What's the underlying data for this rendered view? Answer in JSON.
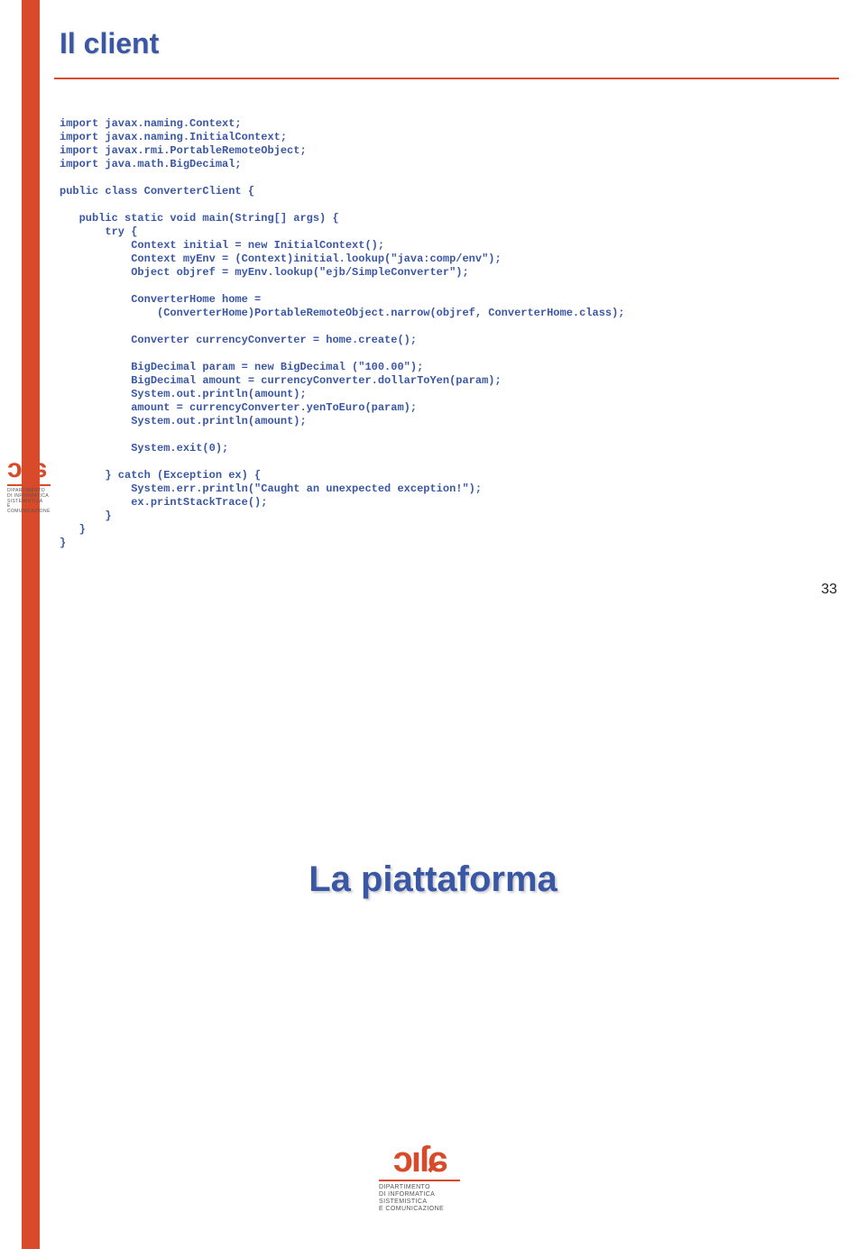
{
  "slide1": {
    "title": "Il client",
    "page_number": "33",
    "code": "import javax.naming.Context;\nimport javax.naming.InitialContext;\nimport javax.rmi.PortableRemoteObject;\nimport java.math.BigDecimal;\n\npublic class ConverterClient {\n\n   public static void main(String[] args) {\n       try {\n           Context initial = new InitialContext();\n           Context myEnv = (Context)initial.lookup(\"java:comp/env\");\n           Object objref = myEnv.lookup(\"ejb/SimpleConverter\");\n\n           ConverterHome home =\n               (ConverterHome)PortableRemoteObject.narrow(objref, ConverterHome.class);\n\n           Converter currencyConverter = home.create();\n\n           BigDecimal param = new BigDecimal (\"100.00\");\n           BigDecimal amount = currencyConverter.dollarToYen(param);\n           System.out.println(amount);\n           amount = currencyConverter.yenToEuro(param);\n           System.out.println(amount);\n\n           System.exit(0);\n\n       } catch (Exception ex) {\n           System.err.println(\"Caught an unexpected exception!\");\n           ex.printStackTrace();\n       }\n   }\n}"
  },
  "slide2": {
    "title": "La piattaforma"
  },
  "logo": {
    "glyph": "ↄıſɕ",
    "line1": "DIPARTIMENTO",
    "line2": "DI INFORMATICA",
    "line3": "SISTEMISTICA",
    "line4": "E COMUNICAZIONE"
  }
}
